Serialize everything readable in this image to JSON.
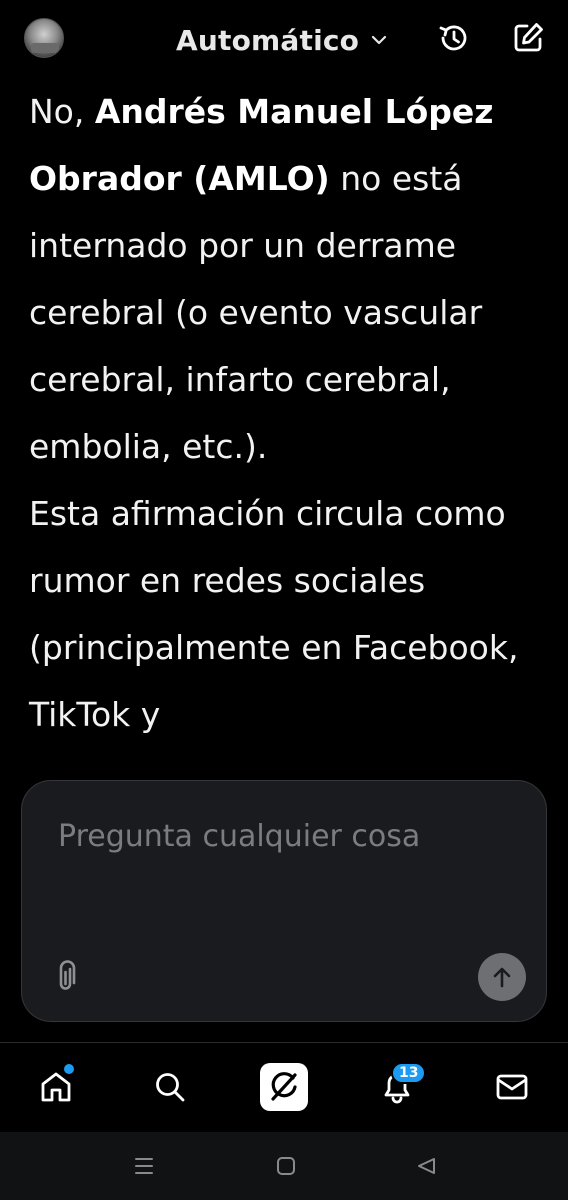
{
  "header": {
    "model_label": "Automático",
    "avatar_icon": "profile-avatar",
    "history_icon": "history-icon",
    "compose_icon": "new-chat-icon"
  },
  "message": {
    "p1_prefix": "No, ",
    "p1_bold": "Andrés Manuel López Obrador (AMLO)",
    "p1_rest": " no está internado por un derrame cerebral (o evento vascular cerebral, infarto cerebral, embolia, etc.).",
    "p2": "Esta afirmación circula como rumor en redes sociales (principalmente en Facebook, TikTok y"
  },
  "composer": {
    "placeholder": "Pregunta cualquier cosa",
    "value": "",
    "attach_icon": "paperclip-icon",
    "send_icon": "arrow-up-icon"
  },
  "bottom_nav": {
    "items": [
      "home-icon",
      "search-icon",
      "grok-icon",
      "bell-icon",
      "mail-icon"
    ],
    "notification_count": "13",
    "accent": "#1d9bf0"
  },
  "system_nav": {
    "items": [
      "recents-icon",
      "home-button-icon",
      "back-icon"
    ]
  }
}
